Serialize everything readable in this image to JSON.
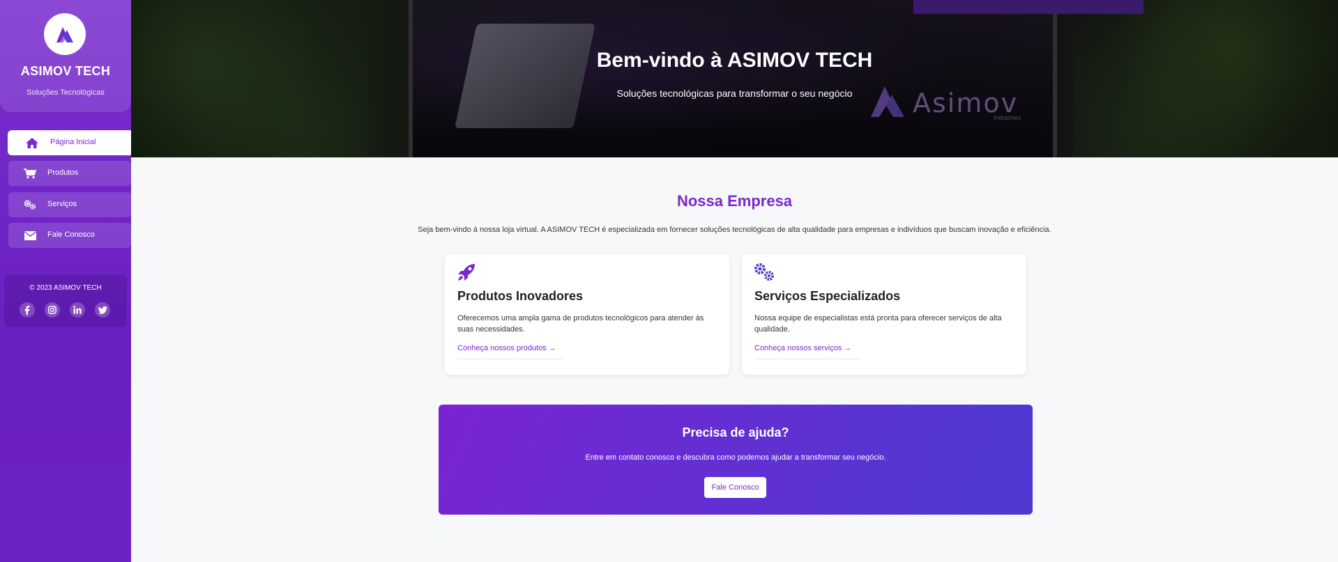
{
  "sidebar": {
    "brand": {
      "title": "ASIMOV TECH",
      "subtitle": "Soluções Tecnológicas",
      "logo_icon": "asimov-logo-icon"
    },
    "items": [
      {
        "label": "Página Inicial",
        "icon": "home-icon",
        "active": true
      },
      {
        "label": "Produtos",
        "icon": "cart-icon",
        "active": false
      },
      {
        "label": "Serviços",
        "icon": "gears-icon",
        "active": false
      },
      {
        "label": "Fale Conosco",
        "icon": "envelope-icon",
        "active": false
      }
    ],
    "footer": {
      "copyright": "© 2023 ASIMOV TECH",
      "social": [
        "facebook-icon",
        "instagram-icon",
        "linkedin-icon",
        "twitter-icon"
      ]
    }
  },
  "hero": {
    "title": "Bem-vindo à ASIMOV TECH",
    "subtitle": "Soluções tecnológicas para transformar o seu negócio",
    "logo_word": "Asimov",
    "logo_sub": "Industries"
  },
  "company": {
    "title": "Nossa Empresa",
    "intro": "Seja bem-vindo à nossa loja virtual. A ASIMOV TECH é especializada em fornecer soluções tecnológicas de alta qualidade para empresas e indivíduos que buscam inovação e eficiência."
  },
  "cards": [
    {
      "icon": "rocket-icon",
      "title": "Produtos Inovadores",
      "description": "Oferecemos uma ampla gama de produtos tecnológicos para atender às suas necessidades.",
      "link": "Conheça nossos produtos"
    },
    {
      "icon": "gears-icon",
      "title": "Serviços Especializados",
      "description": "Nossa equipe de especialistas está pronta para oferecer serviços de alta qualidade.",
      "link": "Conheça nossos serviços"
    }
  ],
  "help": {
    "title": "Precisa de ajuda?",
    "text": "Entre em contato conosco e descubra como podemos ajudar a transformar seu negócio.",
    "button": "Fale Conosco"
  },
  "colors": {
    "primary": "#7a28cc",
    "secondary": "#4d39d1",
    "background": "#f7f8fa"
  }
}
